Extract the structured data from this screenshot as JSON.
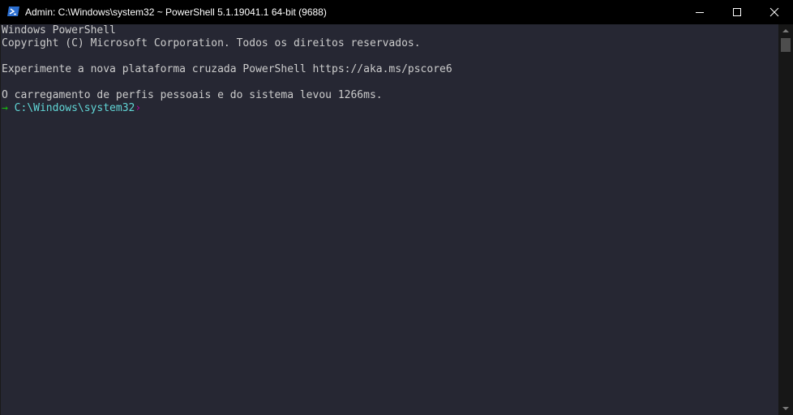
{
  "window": {
    "title": "Admin: C:\\Windows\\system32 ~ PowerShell 5.1.19041.1 64-bit (9688)",
    "icon": "powershell-icon",
    "background": "#262733"
  },
  "controls": {
    "minimize": "minimize-icon",
    "maximize": "maximize-icon",
    "close": "close-icon"
  },
  "console": {
    "lines": [
      "Windows PowerShell",
      "Copyright (C) Microsoft Corporation. Todos os direitos reservados.",
      "",
      "Experimente a nova plataforma cruzada PowerShell https://aka.ms/pscore6",
      "",
      "O carregamento de perfis pessoais e do sistema levou 1266ms."
    ],
    "prompt": {
      "arrow": "→",
      "path": "C:\\Windows\\system32",
      "caret": "›"
    },
    "colors": {
      "text": "#cccccc",
      "arrow": "#16c60c",
      "path": "#61d6d6",
      "caret": "#b4009e"
    }
  },
  "scrollbar": {
    "up_icon": "scroll-up-arrow-icon",
    "down_icon": "scroll-down-arrow-icon"
  }
}
